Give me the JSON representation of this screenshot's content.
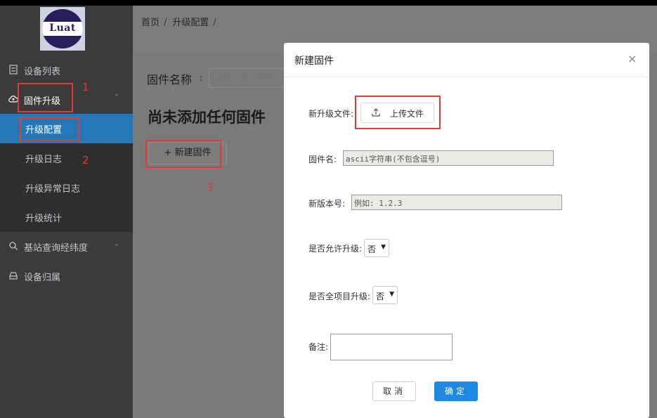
{
  "colors": {
    "accent": "#2478b8",
    "primary_button": "#1e88e5",
    "annotation_red": "#e53935",
    "sidebar_bg": "#3b3b3b"
  },
  "logo": {
    "text": "Luat"
  },
  "sidebar": {
    "items": [
      {
        "label": "设备列表",
        "icon": "list-icon"
      },
      {
        "label": "固件升级",
        "icon": "cloud-upload-icon",
        "chevron": "⌃"
      },
      {
        "label": "升级配置"
      },
      {
        "label": "升级日志"
      },
      {
        "label": "升级异常日志"
      },
      {
        "label": "升级统计"
      },
      {
        "label": "基站查询经纬度",
        "icon": "search-icon",
        "chevron": "⌄"
      },
      {
        "label": "设备归属",
        "icon": "box-icon"
      }
    ]
  },
  "annotations": {
    "n1": "1",
    "n2": "2",
    "n3": "3"
  },
  "breadcrumb": {
    "home": "首页",
    "sep1": "/",
    "current": "升级配置",
    "sep2": "/"
  },
  "filter": {
    "label": "固件名称",
    "colon": ":",
    "placeholder": "请输入固件名称"
  },
  "empty_title": "尚未添加任何固件",
  "new_button": {
    "plus": "+",
    "label": "新建固件"
  },
  "modal": {
    "title": "新建固件",
    "close": "×",
    "upload_label": "新升级文件:",
    "upload_button": "上传文件",
    "name_label": "固件名:",
    "name_placeholder": "ascii字符串(不包含逗号)",
    "version_label": "新版本号:",
    "version_placeholder": "例如: 1.2.3",
    "allow_label": "是否允许升级:",
    "allow_value": "否",
    "all_project_label": "是否全项目升级:",
    "all_project_value": "否",
    "note_label": "备注:",
    "cancel": "取消",
    "ok": "确定"
  }
}
